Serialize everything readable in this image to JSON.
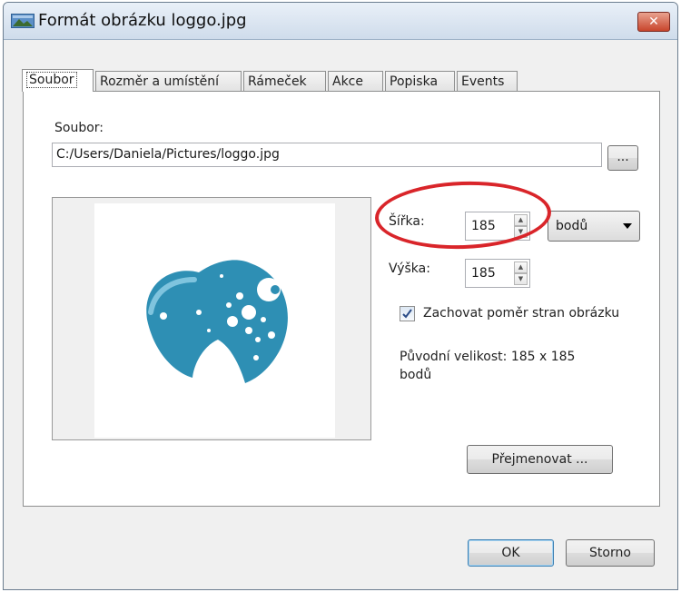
{
  "window": {
    "title": "Formát obrázku loggo.jpg",
    "close_glyph": "✕"
  },
  "tabs": [
    {
      "label": "Soubor",
      "active": true
    },
    {
      "label": "Rozměr a umístění"
    },
    {
      "label": "Rámeček"
    },
    {
      "label": "Akce"
    },
    {
      "label": "Popiska"
    },
    {
      "label": "Events"
    }
  ],
  "file": {
    "label": "Soubor:",
    "path": "C:/Users/Daniela/Pictures/loggo.jpg",
    "browse_label": "..."
  },
  "size": {
    "width_label": "Šířka:",
    "width_value": "185",
    "height_label": "Výška:",
    "height_value": "185",
    "unit": "bodů",
    "keep_ratio_label": "Zachovat poměr stran obrázku",
    "keep_ratio_checked": true,
    "original_size_line1": "Původní velikost: 185 x 185",
    "original_size_line2": "bodů"
  },
  "buttons": {
    "rename": "Přejmenovat ...",
    "ok": "OK",
    "cancel": "Storno"
  },
  "colors": {
    "logo": "#2e8fb4",
    "highlight": "#d9252a"
  },
  "icons": [
    "window-icon",
    "close-icon",
    "spin-up-icon",
    "spin-down-icon",
    "dropdown-arrow-icon",
    "checkmark-icon"
  ]
}
